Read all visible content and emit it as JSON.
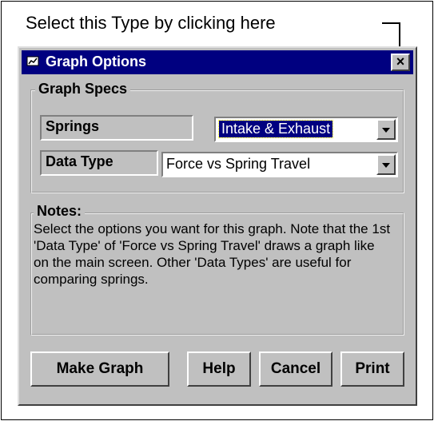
{
  "callout": {
    "text": "Select this Type by clicking here"
  },
  "window": {
    "title": "Graph Options",
    "close_label": "×"
  },
  "graph_specs": {
    "legend": "Graph Specs",
    "springs_label": "Springs",
    "springs_value": "Intake & Exhaust",
    "data_type_label": "Data Type",
    "data_type_value": "Force vs Spring Travel"
  },
  "notes": {
    "legend": "Notes:",
    "text": "Select the options you want for this graph.  Note that the 1st 'Data Type' of 'Force vs Spring Travel' draws a graph like on the main screen.  Other 'Data Types' are useful for comparing springs."
  },
  "buttons": {
    "make_graph": "Make Graph",
    "help": "Help",
    "cancel": "Cancel",
    "print": "Print"
  },
  "colors": {
    "titlebar": "#000080",
    "face": "#c0c0c0"
  }
}
